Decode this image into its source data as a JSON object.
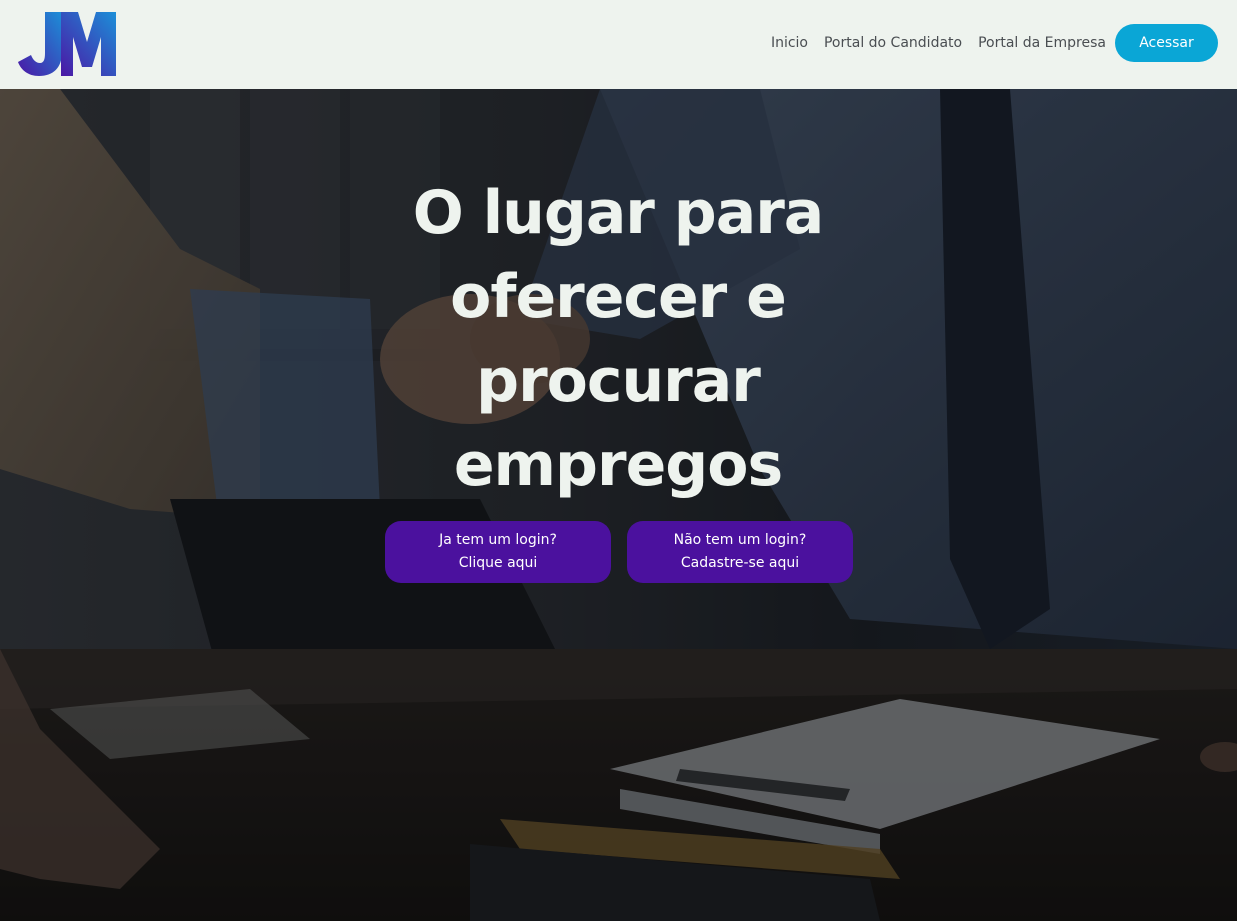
{
  "brand": {
    "logo_text": "JM",
    "logo_gradient": [
      "#4b17a5",
      "#1c8fd8"
    ]
  },
  "nav": {
    "links": [
      "Inicio",
      "Portal do Candidato",
      "Portal da Empresa"
    ],
    "access_label": "Acessar",
    "access_color": "#0aa6d6"
  },
  "hero": {
    "title": "O lugar para oferecer e procurar empregos",
    "button_color": "#4b119e",
    "login_button": {
      "line1": "Ja tem um login?",
      "line2": "Clique aqui"
    },
    "signup_button": {
      "line1": "Não tem um login?",
      "line2": "Cadastre-se aqui"
    }
  }
}
